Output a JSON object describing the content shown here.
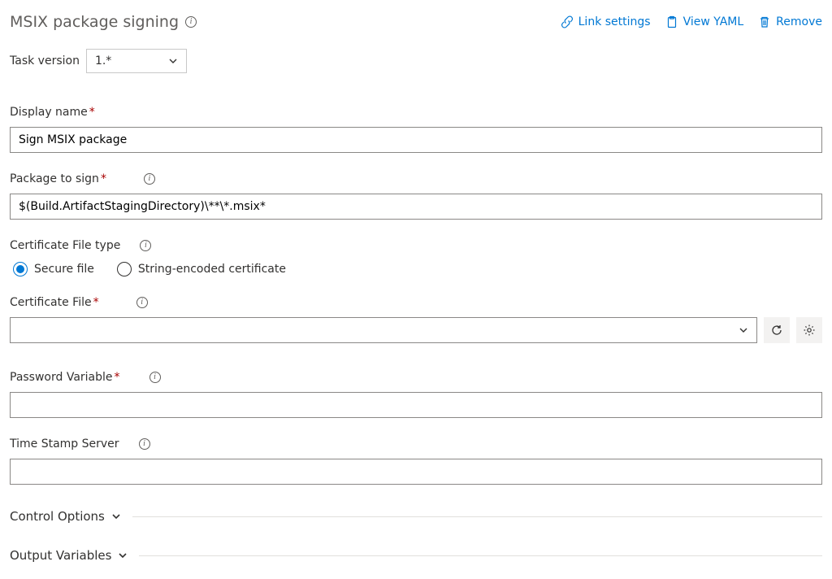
{
  "header": {
    "title": "MSIX package signing",
    "actions": {
      "link_settings": "Link settings",
      "view_yaml": "View YAML",
      "remove": "Remove"
    }
  },
  "task_version": {
    "label": "Task version",
    "value": "1.*"
  },
  "fields": {
    "display_name": {
      "label": "Display name",
      "required": true,
      "value": "Sign MSIX package"
    },
    "package_to_sign": {
      "label": "Package to sign",
      "required": true,
      "value": "$(Build.ArtifactStagingDirectory)\\**\\*.msix*"
    },
    "certificate_file_type": {
      "label": "Certificate File type",
      "options": {
        "secure_file": "Secure file",
        "string_encoded": "String-encoded certificate"
      },
      "selected": "secure_file"
    },
    "certificate_file": {
      "label": "Certificate File",
      "required": true,
      "value": ""
    },
    "password_variable": {
      "label": "Password Variable",
      "required": true,
      "value": ""
    },
    "time_stamp_server": {
      "label": "Time Stamp Server",
      "value": ""
    }
  },
  "sections": {
    "control_options": "Control Options",
    "output_variables": "Output Variables"
  }
}
